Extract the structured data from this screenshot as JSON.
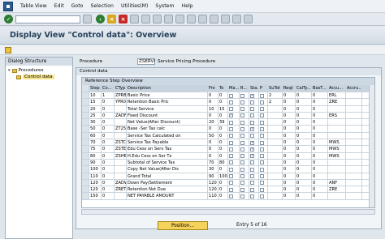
{
  "menu": [
    "Table View",
    "Edit",
    "Goto",
    "Selection",
    "Utilities(M)",
    "System",
    "Help"
  ],
  "title": "Display View \"Control data\": Overview",
  "left": {
    "header": "Dialog Structure",
    "items": [
      "Procedures",
      "Control data"
    ]
  },
  "procedure": {
    "label": "Procedure",
    "value": "ZSERVI",
    "desc": "Service Pricing Procedure"
  },
  "group_title": "Control data",
  "table": {
    "caption": "Reference Step Overview",
    "headers": [
      "Step",
      "Co...",
      "CTyp",
      "Description",
      "Fro",
      "To",
      "Ma...",
      "R...",
      "Sta...",
      "P",
      "SuTot",
      "Reqt",
      "CalTy...",
      "BasT...",
      "Accu...",
      "Accru..."
    ],
    "rows": [
      {
        "step": "10",
        "co": "1",
        "ctyp": "ZPRB",
        "desc": "Basic Price",
        "fro": "0",
        "to": "0",
        "ma": false,
        "r": false,
        "sta": true,
        "p": false,
        "sutot": "2",
        "reqt": "0",
        "calty": "0",
        "bast": "0",
        "accu": "ERL",
        "accru": ""
      },
      {
        "step": "15",
        "co": "0",
        "ctyp": "YPR0",
        "desc": "Retention Basic Pric",
        "fro": "0",
        "to": "0",
        "ma": false,
        "r": false,
        "sta": false,
        "p": false,
        "sutot": "2",
        "reqt": "0",
        "calty": "0",
        "bast": "0",
        "accu": "ZRE",
        "accru": ""
      },
      {
        "step": "20",
        "co": "0",
        "ctyp": "",
        "desc": "Total Service",
        "fro": "10",
        "to": "15",
        "ma": false,
        "r": false,
        "sta": false,
        "p": false,
        "sutot": "",
        "reqt": "0",
        "calty": "0",
        "bast": "0",
        "accu": "",
        "accru": ""
      },
      {
        "step": "25",
        "co": "0",
        "ctyp": "ZADF",
        "desc": "Fixed Discount",
        "fro": "0",
        "to": "0",
        "ma": true,
        "r": false,
        "sta": false,
        "p": false,
        "sutot": "",
        "reqt": "0",
        "calty": "0",
        "bast": "0",
        "accu": "ERS",
        "accru": ""
      },
      {
        "step": "30",
        "co": "0",
        "ctyp": "",
        "desc": "Net Value(After Discount)",
        "fro": "20",
        "to": "39",
        "ma": false,
        "r": false,
        "sta": false,
        "p": false,
        "sutot": "",
        "reqt": "0",
        "calty": "0",
        "bast": "0",
        "accu": "",
        "accru": ""
      },
      {
        "step": "50",
        "co": "0",
        "ctyp": "ZT25",
        "desc": "Base -Ser Tax calc",
        "fro": "0",
        "to": "0",
        "ma": false,
        "r": false,
        "sta": true,
        "p": false,
        "sutot": "",
        "reqt": "0",
        "calty": "0",
        "bast": "0",
        "accu": "",
        "accru": ""
      },
      {
        "step": "60",
        "co": "0",
        "ctyp": "",
        "desc": "Service Tax Calculated on",
        "fro": "50",
        "to": "0",
        "ma": false,
        "r": false,
        "sta": false,
        "p": false,
        "sutot": "",
        "reqt": "0",
        "calty": "0",
        "bast": "0",
        "accu": "",
        "accru": ""
      },
      {
        "step": "70",
        "co": "0",
        "ctyp": "ZSTC",
        "desc": "Service Tax Payable",
        "fro": "0",
        "to": "0",
        "ma": false,
        "r": false,
        "sta": true,
        "p": false,
        "sutot": "",
        "reqt": "0",
        "calty": "0",
        "bast": "0",
        "accu": "MWS",
        "accru": ""
      },
      {
        "step": "75",
        "co": "0",
        "ctyp": "ZSTE",
        "desc": "Edu Cess on Serv Tax",
        "fro": "0",
        "to": "0",
        "ma": false,
        "r": false,
        "sta": true,
        "p": false,
        "sutot": "",
        "reqt": "0",
        "calty": "0",
        "bast": "0",
        "accu": "MWS",
        "accru": ""
      },
      {
        "step": "80",
        "co": "0",
        "ctyp": "ZSHE",
        "desc": "H.Edu Cess on Ser Tx",
        "fro": "0",
        "to": "0",
        "ma": false,
        "r": false,
        "sta": true,
        "p": false,
        "sutot": "",
        "reqt": "0",
        "calty": "0",
        "bast": "0",
        "accu": "MWS",
        "accru": ""
      },
      {
        "step": "90",
        "co": "0",
        "ctyp": "",
        "desc": "Subtotal of Service Tax",
        "fro": "70",
        "to": "80",
        "ma": false,
        "r": false,
        "sta": false,
        "p": false,
        "sutot": "",
        "reqt": "0",
        "calty": "0",
        "bast": "0",
        "accu": "",
        "accru": ""
      },
      {
        "step": "100",
        "co": "0",
        "ctyp": "",
        "desc": "Copy Net Value(After Dis",
        "fro": "30",
        "to": "0",
        "ma": false,
        "r": false,
        "sta": false,
        "p": false,
        "sutot": "",
        "reqt": "0",
        "calty": "0",
        "bast": "0",
        "accu": "",
        "accru": ""
      },
      {
        "step": "110",
        "co": "0",
        "ctyp": "",
        "desc": "Grand Total",
        "fro": "90",
        "to": "100",
        "ma": false,
        "r": false,
        "sta": false,
        "p": false,
        "sutot": "",
        "reqt": "0",
        "calty": "0",
        "bast": "0",
        "accu": "",
        "accru": ""
      },
      {
        "step": "120",
        "co": "0",
        "ctyp": "ZADW",
        "desc": "Down Pay/Settlement",
        "fro": "120",
        "to": "0",
        "ma": false,
        "r": false,
        "sta": false,
        "p": false,
        "sutot": "",
        "reqt": "0",
        "calty": "0",
        "bast": "0",
        "accu": "ANF",
        "accru": ""
      },
      {
        "step": "120",
        "co": "0",
        "ctyp": "ZRET",
        "desc": "Retention Not Due",
        "fro": "120",
        "to": "0",
        "ma": false,
        "r": false,
        "sta": false,
        "p": false,
        "sutot": "",
        "reqt": "0",
        "calty": "0",
        "bast": "0",
        "accu": "ZRE",
        "accru": ""
      },
      {
        "step": "150",
        "co": "0",
        "ctyp": "",
        "desc": "NET PAYABLE AMOUNT",
        "fro": "110",
        "to": "0",
        "ma": false,
        "r": false,
        "sta": false,
        "p": false,
        "sutot": "",
        "reqt": "0",
        "calty": "0",
        "bast": "0",
        "accu": "",
        "accru": ""
      }
    ]
  },
  "footer": {
    "position_button": "Position...",
    "entry_text": "Entry 5 of 16"
  }
}
